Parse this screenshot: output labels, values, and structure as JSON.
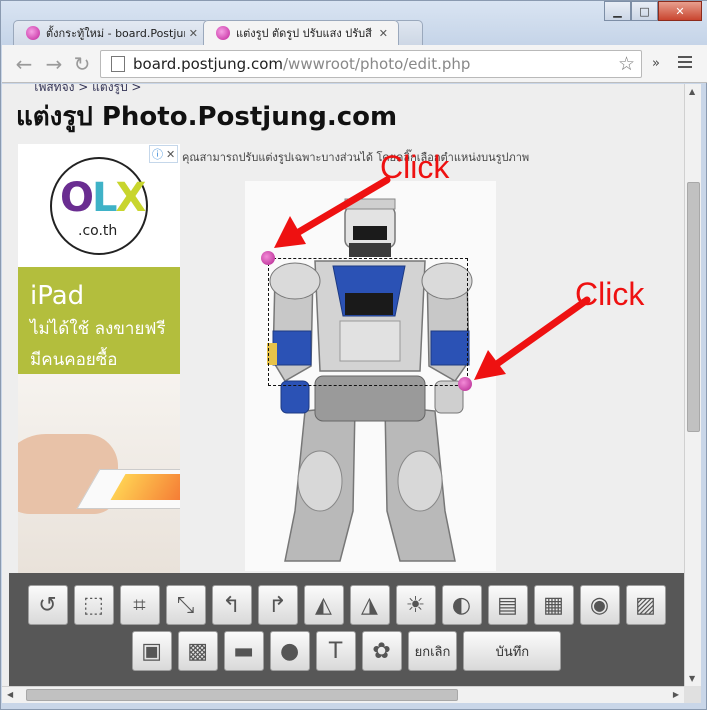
{
  "browser": {
    "tabs": [
      {
        "label": "ตั้งกระทู้ใหม่ - board.Postjur",
        "active": false
      },
      {
        "label": "แต่งรูป ตัดรูป ปรับแสง ปรับสี ทํ",
        "active": true
      }
    ],
    "url_host": "board.postjung.com",
    "url_path": "/wwwroot/photo/edit.php",
    "icons": {
      "back": "back-arrow-icon",
      "forward": "forward-arrow-icon",
      "star": "bookmark-star-icon",
      "menu": "hamburger-menu-icon"
    },
    "more": "»"
  },
  "page": {
    "breadcrumb": "โพสท์จัง > แต่งรูป >",
    "title": "แต่งรูป Photo.Postjung.com",
    "instruction": "คุณสามารถปรับแต่งรูปเฉพาะบางส่วนได้ โดยคลิ๊กเลือกตำแหน่งบนรูปภาพ",
    "annotations": {
      "click_top": "Click",
      "click_right": "Click"
    },
    "colors": {
      "annotation": "#ee1111",
      "handle": "#c0279b"
    }
  },
  "ad": {
    "brand_o": "O",
    "brand_l": "L",
    "brand_x": "X",
    "brand_domain": ".co.th",
    "headline": "iPad",
    "line1": "ไม่ได้ใช้  ลงขายฟรี",
    "line2": "มีคนคอยซื้อ",
    "adchoice_icon": "ⓘ",
    "adchoice_close": "✕"
  },
  "tools": {
    "row1": [
      {
        "name": "rotate-icon",
        "glyph": "↺"
      },
      {
        "name": "select-rect-icon",
        "glyph": "⬚"
      },
      {
        "name": "crop-icon",
        "glyph": "⌗"
      },
      {
        "name": "resize-icon",
        "glyph": "⤡"
      },
      {
        "name": "undo-icon",
        "glyph": "↰"
      },
      {
        "name": "redo-icon",
        "glyph": "↱"
      },
      {
        "name": "flip-horizontal-icon",
        "glyph": "◭"
      },
      {
        "name": "flip-vertical-icon",
        "glyph": "◮"
      },
      {
        "name": "brightness-icon",
        "glyph": "☀"
      },
      {
        "name": "contrast-icon",
        "glyph": "◐"
      },
      {
        "name": "rgb-color-icon",
        "glyph": "▤"
      },
      {
        "name": "color-levels-icon",
        "glyph": "▦"
      },
      {
        "name": "color-wheel-icon",
        "glyph": "◉"
      },
      {
        "name": "grayscale-icon",
        "glyph": "▨"
      }
    ],
    "row2": [
      {
        "name": "image-effect-icon",
        "glyph": "▣"
      },
      {
        "name": "pixelate-icon",
        "glyph": "▩"
      },
      {
        "name": "censor-bar-icon",
        "glyph": "▬"
      },
      {
        "name": "blur-icon",
        "glyph": "●"
      },
      {
        "name": "text-tool-icon",
        "glyph": "T"
      },
      {
        "name": "sticker-flower-icon",
        "glyph": "✿"
      }
    ],
    "cancel_label": "ยกเลิก",
    "save_label": "บันทึก"
  }
}
